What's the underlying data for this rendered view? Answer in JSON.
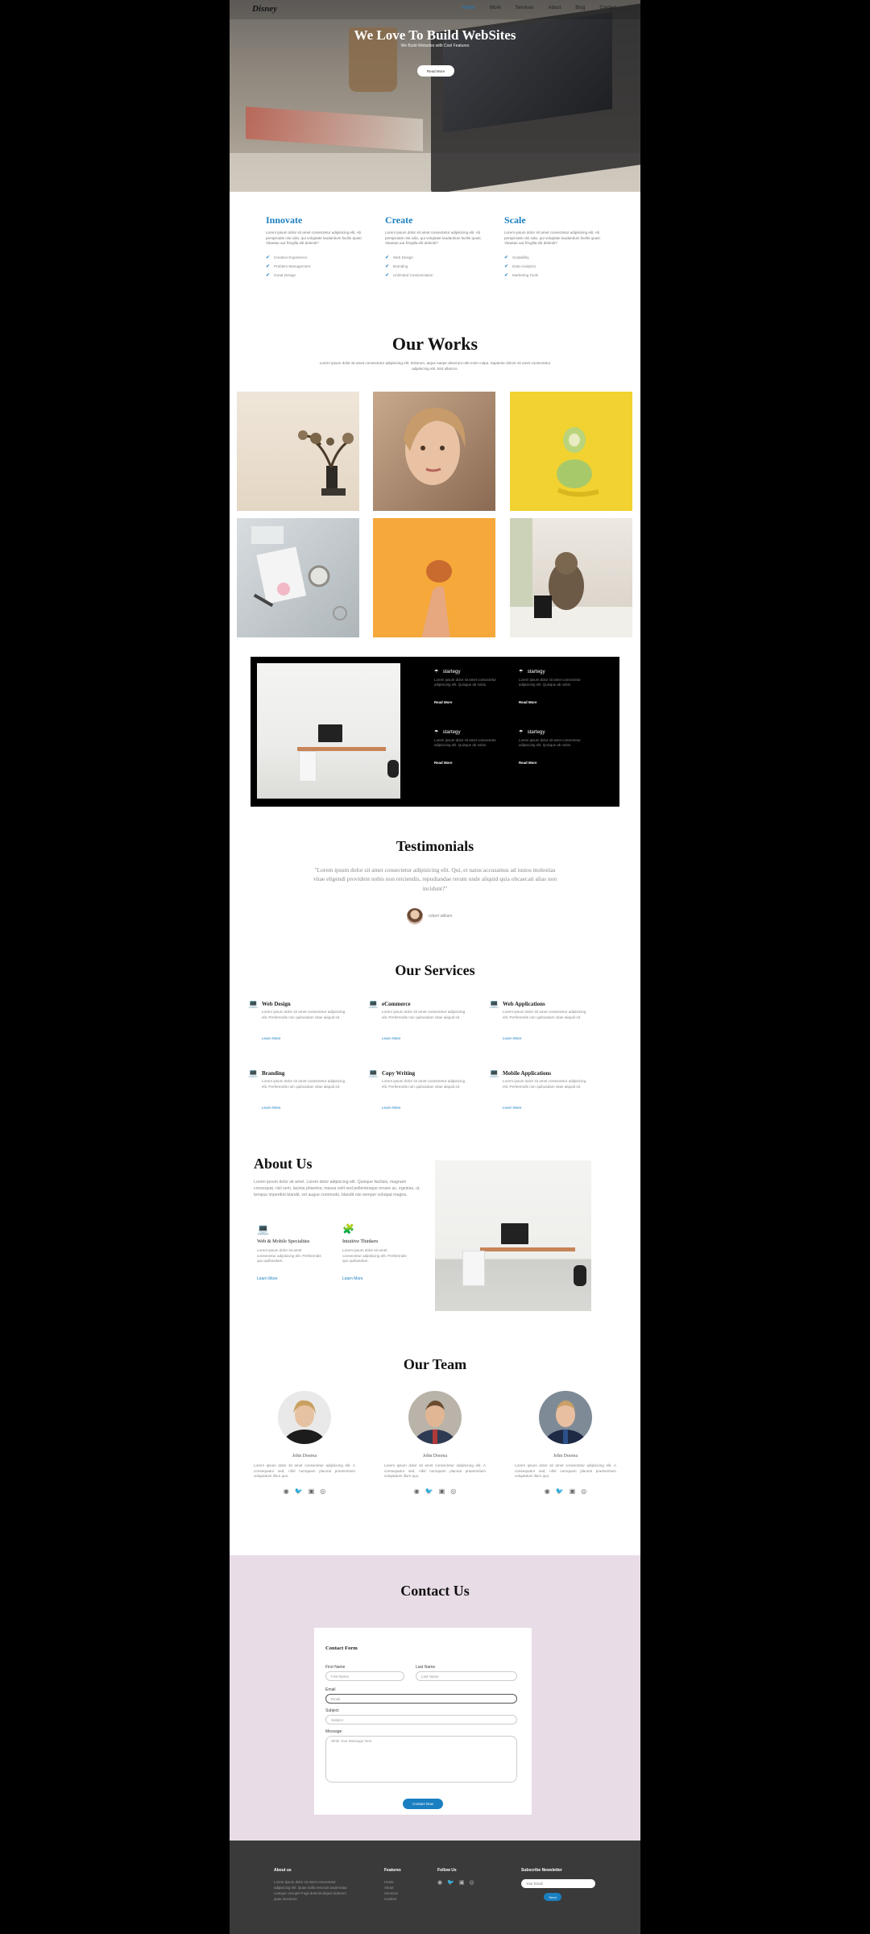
{
  "nav": {
    "logo": "Disney",
    "links": [
      "Home",
      "Work",
      "Services",
      "About",
      "Blog",
      "Contact"
    ]
  },
  "hero": {
    "title": "We Love To Build WebSites",
    "subtitle": "We Build Websites with Cool Features",
    "button": "Read More"
  },
  "features": [
    {
      "title": "Innovate",
      "text": "Lorem ipsum dolor sit amet consectetur adipisicing elit. Ab perspiciatis nisi odio, qui voluptate laudantium facilis quasi. Vitaetae aut fringilla elit deleniti?",
      "items": [
        "Creative Experience",
        "Problem Management",
        "Great Design"
      ]
    },
    {
      "title": "Create",
      "text": "Lorem ipsum dolor sit amet consectetur adipisicing elit. Ab perspiciatis nisi odio, qui voluptate laudantium facilis quasi. Vitaetae aut fringilla elit deleniti?",
      "items": [
        "Web Design",
        "Branding",
        "Unlimited Customization"
      ]
    },
    {
      "title": "Scale",
      "text": "Lorem ipsum dolor sit amet consectetur adipisicing elit. Ab perspiciatis nisi odio, qui voluptate laudantium facilis quasi. Vitaetae aut fringilla elit deleniti?",
      "items": [
        "Scalability",
        "Data Analytics",
        "Marketing Tools"
      ]
    }
  ],
  "works": {
    "title": "Our Works",
    "desc": "Lorem ipsum dolor sit amet consectetur adipisicing elit. Dolorum, atque saepe deserunt odit enim culpa. Sapiente dolore sit amet consectetur adipisicing elit. Sint ullamco."
  },
  "strategy": {
    "items": [
      {
        "title": "startegy",
        "text": "Lorem ipsum dolor sit amet consectetur adipisicing elit. Quisque ab nobis.",
        "link": "Read More"
      },
      {
        "title": "startegy",
        "text": "Lorem ipsum dolor sit amet consectetur adipisicing elit. Quisque ab nobis.",
        "link": "Read More"
      },
      {
        "title": "startegy",
        "text": "Lorem ipsum dolor sit amet consectetur adipisicing elit. Quisque ab nobis.",
        "link": "Read More"
      },
      {
        "title": "startegy",
        "text": "Lorem ipsum dolor sit amet consectetur adipisicing elit. Quisque ab nobis.",
        "link": "Read More"
      }
    ]
  },
  "testimonials": {
    "title": "Testimonials",
    "quote": "\"Lorem ipsum dolor sit amet consectetur adipisicing elit. Qui, et natus accusamus ad iustos molestias vitae eligendi provident nobis non reiciendis, repudiandae rerum unde aliquid quia obcaecati alias non incidunt?\"",
    "author": "robert william"
  },
  "services": {
    "title": "Our Services",
    "items": [
      {
        "title": "Web Design",
        "text": "Lorem ipsum dolor sit amet consectetur adipisicing elit. Perferendis non quibusdam vitae aliquid sit.",
        "link": "Learn More"
      },
      {
        "title": "eCommerce",
        "text": "Lorem ipsum dolor sit amet consectetur adipisicing elit. Perferendis non quibusdam vitae aliquid sit.",
        "link": "Learn More"
      },
      {
        "title": "Web Applications",
        "text": "Lorem ipsum dolor sit amet consectetur adipisicing elit. Perferendis non quibusdam vitae aliquid sit.",
        "link": "Learn More"
      },
      {
        "title": "Branding",
        "text": "Lorem ipsum dolor sit amet consectetur adipisicing elit. Perferendis non quibusdam vitae aliquid sit.",
        "link": "Learn More"
      },
      {
        "title": "Copy Writing",
        "text": "Lorem ipsum dolor sit amet consectetur adipisicing elit. Perferendis non quibusdam vitae aliquid sit.",
        "link": "Learn More"
      },
      {
        "title": "Mobile Applications",
        "text": "Lorem ipsum dolor sit amet consectetur adipisicing elit. Perferendis non quibusdam vitae aliquid sit.",
        "link": "Learn More"
      }
    ]
  },
  "about": {
    "title": "About Us",
    "text": "Lorem ipsum dolor sit amet. Lorem dolor adipiscing elit. Quisque facilisis, magnam consequat, nisl sem, lacinia pharetra, massa velit sed pellentesque ornare ac, egestas, ut, tempus imperdiet blandit, vel augue commodo, blandit nisi semper volutpat magna.",
    "items": [
      {
        "title": "Web & Mobile Specialties",
        "text": "Lorem ipsum dolor sit amet consectetur adipisicing elit. Perferendis quo quibusdam.",
        "link": "Learn More"
      },
      {
        "title": "Intuitive Thinkers",
        "text": "Lorem ipsum dolor sit amet consectetur adipisicing elit. Perferendis quo quibusdam.",
        "link": "Learn More"
      }
    ]
  },
  "team": {
    "title": "Our Team",
    "members": [
      {
        "name": "John Doerea",
        "text": "Lorem ipsum dolor sit amet consectetur adipisicing elit. A consequatur sed, nihil numquam placeat praesentium voluptatum illum quo."
      },
      {
        "name": "John Doerea",
        "text": "Lorem ipsum dolor sit amet consectetur adipisicing elit. A consequatur sed, nihil numquam placeat praesentium voluptatum illum quo."
      },
      {
        "name": "John Doerea",
        "text": "Lorem ipsum dolor sit amet consectetur adipisicing elit. A consequatur sed, nihil numquam placeat praesentium voluptatum illum quo."
      }
    ]
  },
  "contact": {
    "title": "Contact Us",
    "form_title": "Contact Form",
    "first_label": "First Name",
    "first_ph": "First Name",
    "last_label": "Last Name",
    "last_ph": "Last Name",
    "email_label": "Email",
    "email_ph": "Email",
    "subject_label": "Subject",
    "subject_ph": "Subject",
    "message_label": "Message",
    "message_ph": "Write Your Message here",
    "button": "Contact Now"
  },
  "footer": {
    "about_title": "About us",
    "about_text": "Lorem ipsum dolor sit amet consectetur adipisicing elit. Quae nulla nesciunt aspernatur cumque corrupti! Fugit deleniti aliquid dolorem quas inventore.",
    "features_title": "Features",
    "features": [
      "Home",
      "About",
      "Services",
      "Contact"
    ],
    "follow_title": "Follow Us",
    "newsletter_title": "Subscribe Newsletter",
    "email_ph": "Your Email",
    "subscribe": "Send"
  },
  "colors": {
    "accent": "#1a7fc1",
    "contact_bg": "#e8dce7",
    "footer_bg": "#3a3a3a"
  }
}
